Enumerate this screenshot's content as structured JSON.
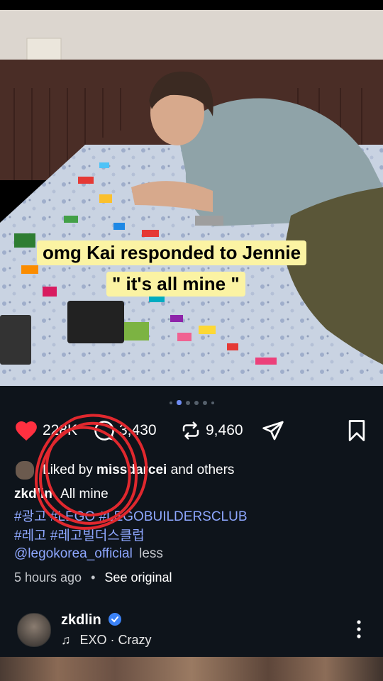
{
  "caption": {
    "line1": "omg Kai responded to Jennie",
    "line2": "\" it's all mine \""
  },
  "carousel": {
    "count": 6,
    "active": 1
  },
  "actions": {
    "likes": "228K",
    "comments": "3,430",
    "reposts": "9,460"
  },
  "liked_by": {
    "prefix": "Liked by ",
    "user": "missdarcei",
    "suffix": " and others"
  },
  "post": {
    "username": "zkdlin",
    "caption": "All mine",
    "hashtags_line1": "#광고 #LEGO #LEGOBUILDERSCLUB",
    "hashtags_line2": "#레고 #레고빌더스클럽",
    "mention": "@legokorea_official",
    "less_label": "less",
    "time": "5 hours ago",
    "separator": "•",
    "see_original": "See original"
  },
  "author": {
    "name": "zkdlin",
    "music": "EXO · Crazy"
  },
  "colors": {
    "like": "#ff3040",
    "accent_link": "#8ea7ff",
    "caption_bg": "#fbf3a3",
    "verified": "#3b82f6",
    "annotation": "#e0282e"
  }
}
